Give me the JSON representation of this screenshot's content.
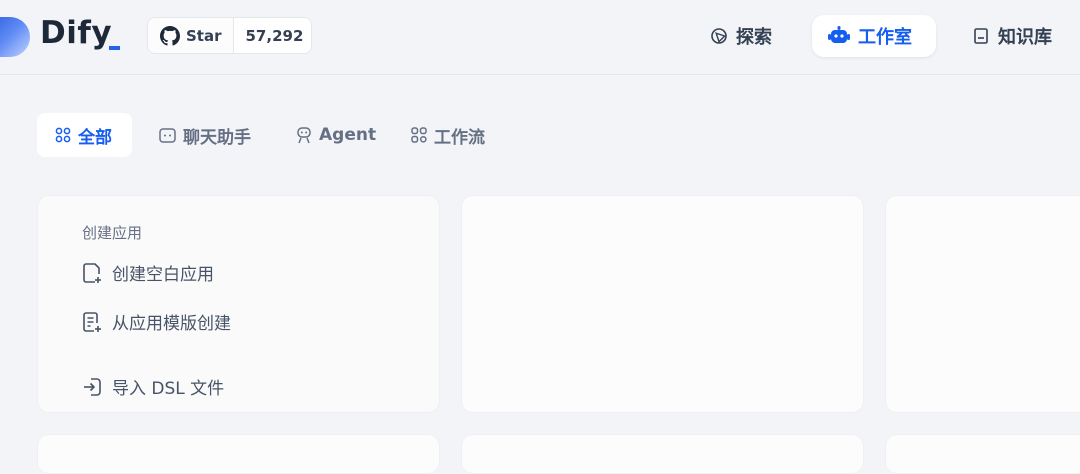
{
  "header": {
    "logo_text": "Dify",
    "github": {
      "icon": "github-icon",
      "star_label": "Star",
      "star_count": "57,292"
    },
    "nav": [
      {
        "label": "探索",
        "icon": "compass-icon"
      },
      {
        "label": "工作室",
        "icon": "robot-icon",
        "active": true
      },
      {
        "label": "知识库",
        "icon": "book-icon"
      }
    ]
  },
  "tabs": [
    {
      "label": "全部",
      "icon": "grid-icon",
      "active": true
    },
    {
      "label": "聊天助手",
      "icon": "chat-icon"
    },
    {
      "label": "Agent",
      "icon": "agent-icon"
    },
    {
      "label": "工作流",
      "icon": "workflow-icon"
    }
  ],
  "create_card": {
    "title": "创建应用",
    "items": [
      {
        "label": "创建空白应用",
        "icon": "new-file-icon"
      },
      {
        "label": "从应用模版创建",
        "icon": "template-icon"
      },
      {
        "label": "导入 DSL 文件",
        "icon": "import-icon"
      }
    ]
  },
  "colors": {
    "accent": "#155eef",
    "background": "#f2f4f7",
    "card": "#fcfcfd"
  }
}
